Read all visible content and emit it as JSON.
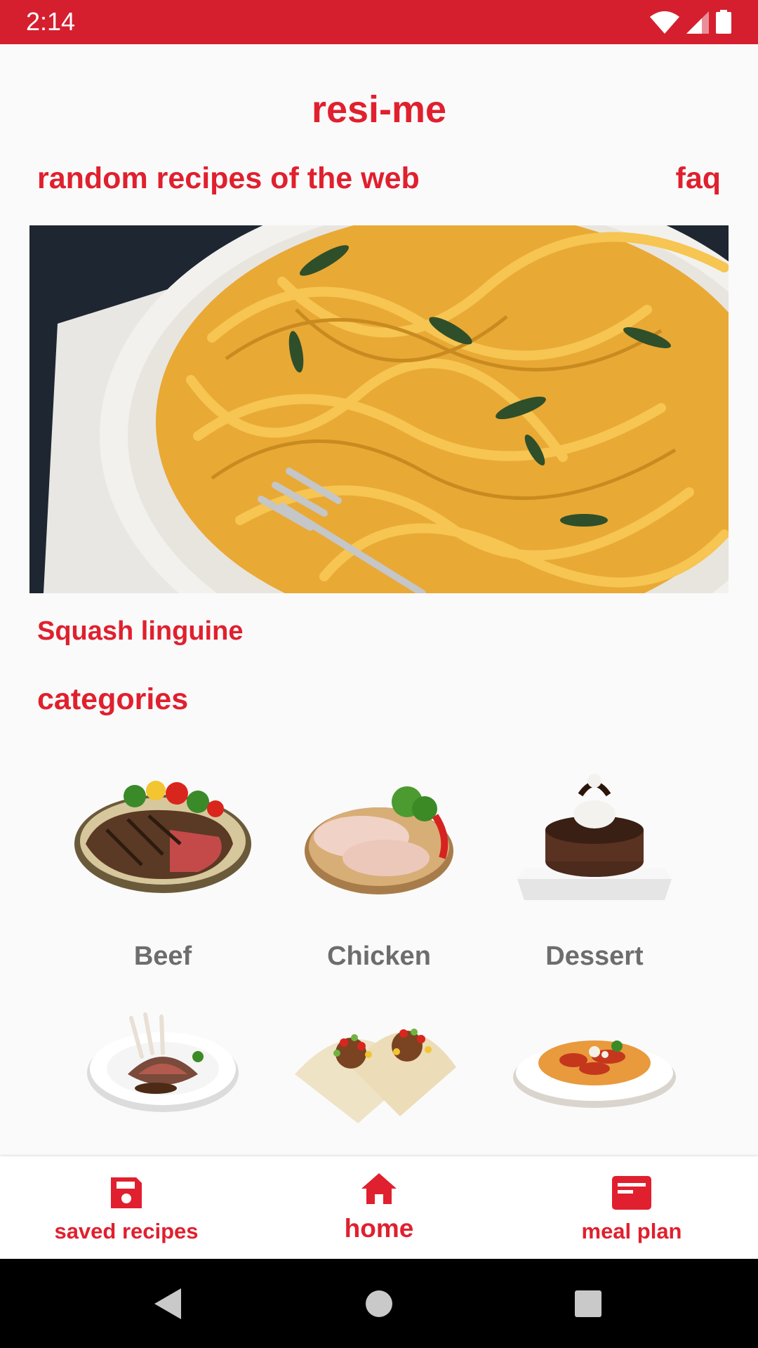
{
  "status_bar": {
    "time": "2:14",
    "icons": [
      "wifi-icon",
      "signal-icon",
      "battery-icon"
    ]
  },
  "app": {
    "title": "resi-me"
  },
  "links": {
    "random": "random recipes of the web",
    "faq": "faq"
  },
  "featured": {
    "name": "Squash linguine",
    "image": "pasta-photo"
  },
  "categories": {
    "title": "categories",
    "items": [
      {
        "label": "Beef",
        "image": "steak-image"
      },
      {
        "label": "Chicken",
        "image": "chicken-image"
      },
      {
        "label": "Dessert",
        "image": "dessert-image"
      },
      {
        "label": "",
        "image": "lamb-image"
      },
      {
        "label": "",
        "image": "tacos-image"
      },
      {
        "label": "",
        "image": "pasta-dish-image"
      }
    ]
  },
  "bottom_nav": {
    "items": [
      {
        "label": "saved recipes",
        "icon": "save-icon"
      },
      {
        "label": "home",
        "icon": "home-icon",
        "active": true
      },
      {
        "label": "meal plan",
        "icon": "calendar-card-icon"
      }
    ]
  },
  "colors": {
    "accent": "#e0202e",
    "status_bar": "#d51f2f",
    "label_gray": "#6d6d6d"
  }
}
